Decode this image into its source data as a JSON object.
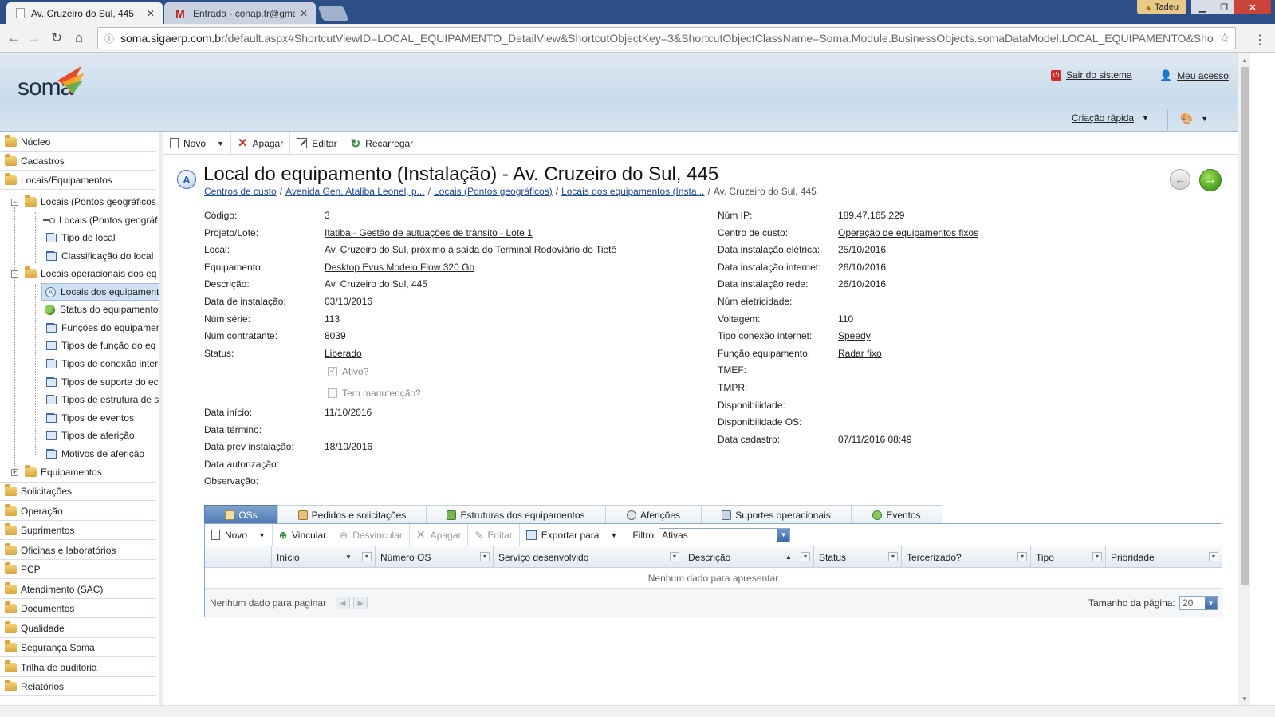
{
  "browser": {
    "tabs": [
      {
        "title": "Av. Cruzeiro do Sul, 445",
        "close": "✕"
      },
      {
        "title": "Entrada - conap.tr@gma",
        "close": "✕",
        "favicon": "M"
      }
    ],
    "user_chip": "Tadeu",
    "url_host": "soma.sigaerp.com.br",
    "url_rest": "/default.aspx#ShortcutViewID=LOCAL_EQUIPAMENTO_DetailView&ShortcutObjectKey=3&ShortcutObjectClassName=Soma.Module.BusinessObjects.somaDataModel.LOCAL_EQUIPAMENTO&Shortcutmoc"
  },
  "header": {
    "logo": "soma",
    "logout": "Sair do sistema",
    "access": "Meu acesso",
    "quick_create": "Criação rápida"
  },
  "sidebar": {
    "groups_top": [
      "Núcleo",
      "Cadastros",
      "Locais/Equipamentos"
    ],
    "tree": {
      "node1": "Locais (Pontos geográficos",
      "node1_children": [
        "Locais (Pontos geográf",
        "Tipo de local",
        "Classificação do local"
      ],
      "node2": "Locais operacionais dos eq",
      "node2_children": [
        "Locais dos equipament",
        "Status do equipamento",
        "Funções do equipamen",
        "Tipos de função do eq",
        "Tipos de conexão inter",
        "Tipos de suporte do ec",
        "Tipos de estrutura de s",
        "Tipos de eventos",
        "Tipos de aferição",
        "Motivos de aferição"
      ],
      "node3": "Equipamentos"
    },
    "groups_bottom": [
      "Solicitações",
      "Operação",
      "Suprimentos",
      "Oficinas e laboratórios",
      "PCP",
      "Atendimento (SAC)",
      "Documentos",
      "Qualidade",
      "Segurança Soma",
      "Trilha de auditoria",
      "Relatórios"
    ]
  },
  "toolbar": {
    "new": "Novo",
    "delete": "Apagar",
    "edit": "Editar",
    "reload": "Recarregar"
  },
  "detail": {
    "badge": "A",
    "title": "Local do equipamento (Instalação) - Av. Cruzeiro do Sul, 445",
    "breadcrumb": [
      "Centros de custo",
      "Avenida Gen. Ataliba Leonel, p...",
      "Locais (Pontos geográficos)",
      "Locais dos equipamentos (Insta..."
    ],
    "breadcrumb_current": "Av. Cruzeiro do Sul, 445",
    "left_fields": [
      {
        "label": "Código:",
        "value": "3"
      },
      {
        "label": "Projeto/Lote:",
        "value": "Itatiba - Gestão de autuações de trânsito - Lote 1",
        "link": true
      },
      {
        "label": "Local:",
        "value": "Av. Cruzeiro do Sul, próximo à saída do Terminal Rodoviário do Tietê",
        "link": true
      },
      {
        "label": "Equipamento:",
        "value": "Desktop Evus Modelo Flow 320 Gb",
        "link": true
      },
      {
        "label": "Descrição:",
        "value": "Av. Cruzeiro do Sul, 445"
      },
      {
        "label": "Data de instalação:",
        "value": "03/10/2016"
      },
      {
        "label": "Núm série:",
        "value": "113"
      },
      {
        "label": "Núm contratante:",
        "value": "8039"
      },
      {
        "label": "Status:",
        "value": "Liberado",
        "link": true
      }
    ],
    "checkbox_active": "Ativo?",
    "checkbox_maint": "Tem manutenção?",
    "left_fields2": [
      {
        "label": "Data início:",
        "value": "11/10/2016"
      },
      {
        "label": "Data término:",
        "value": ""
      },
      {
        "label": "Data prev instalação:",
        "value": "18/10/2016"
      },
      {
        "label": "Data autorização:",
        "value": ""
      },
      {
        "label": "Observação:",
        "value": ""
      }
    ],
    "right_fields": [
      {
        "label": "Núm IP:",
        "value": "189.47.165.229"
      },
      {
        "label": "Centro de custo:",
        "value": "Operação de equipamentos fixos",
        "link": true
      },
      {
        "label": "Data instalação elétrica:",
        "value": "25/10/2016"
      },
      {
        "label": "Data instalação internet:",
        "value": "26/10/2016"
      },
      {
        "label": "Data instalação rede:",
        "value": "26/10/2016"
      },
      {
        "label": "Núm eletricidade:",
        "value": ""
      },
      {
        "label": "Voltagem:",
        "value": "110"
      },
      {
        "label": "Tipo conexão internet:",
        "value": "Speedy",
        "link": true
      },
      {
        "label": "Função equipamento:",
        "value": "Radar fixo",
        "link": true
      },
      {
        "label": "TMEF:",
        "value": ""
      },
      {
        "label": "TMPR:",
        "value": ""
      },
      {
        "label": "Disponibilidade:",
        "value": ""
      },
      {
        "label": "Disponibilidade OS:",
        "value": ""
      },
      {
        "label": "Data cadastro:",
        "value": "07/11/2016 08:49"
      }
    ]
  },
  "tabs": [
    "OSs",
    "Pedidos e solicitações",
    "Estruturas dos equipamentos",
    "Aferições",
    "Suportes operacionais",
    "Eventos"
  ],
  "grid": {
    "toolbar": {
      "new": "Novo",
      "link": "Vincular",
      "unlink": "Desvincular",
      "delete": "Apagar",
      "edit": "Editar",
      "export": "Exportar para",
      "filter_label": "Filtro",
      "filter_value": "Ativas"
    },
    "columns": [
      "Início",
      "Número OS",
      "Serviço desenvolvido",
      "Descrição",
      "Status",
      "Tercerizado?",
      "Tipo",
      "Prioridade"
    ],
    "empty_text": "Nenhum dado para apresentar",
    "pager_text": "Nenhum dado para paginar",
    "page_size_label": "Tamanho da página:",
    "page_size": "20"
  },
  "colors": {
    "tabbar": "#2b4f86",
    "link": "#1f4a96",
    "active_tab": "#4f7bb3"
  }
}
